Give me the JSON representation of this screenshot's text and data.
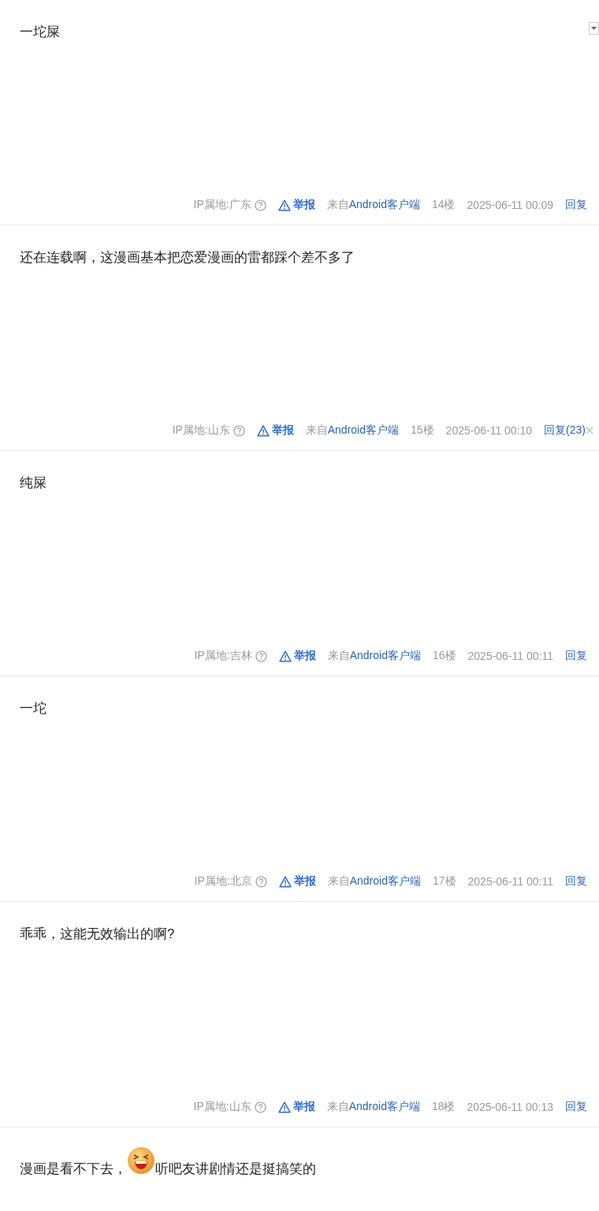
{
  "posts": [
    {
      "content": [
        {
          "kind": "text",
          "text": "一坨屎"
        }
      ],
      "menu": true,
      "closable": false,
      "ip": "IP属地:广东",
      "report": "举报",
      "source_prefix": "来自",
      "source": "Android客户端",
      "floor": "14楼",
      "time": "2025-06-11 00:09",
      "reply": "回复"
    },
    {
      "content": [
        {
          "kind": "text",
          "text": "还在连载啊，这漫画基本把恋爱漫画的雷都踩个差不多了"
        }
      ],
      "menu": false,
      "closable": true,
      "ip": "IP属地:山东",
      "report": "举报",
      "source_prefix": "来自",
      "source": "Android客户端",
      "floor": "15楼",
      "time": "2025-06-11 00:10",
      "reply": "回复(23)"
    },
    {
      "content": [
        {
          "kind": "text",
          "text": "纯屎"
        }
      ],
      "menu": false,
      "closable": false,
      "ip": "IP属地:吉林",
      "report": "举报",
      "source_prefix": "来自",
      "source": "Android客户端",
      "floor": "16楼",
      "time": "2025-06-11 00:11",
      "reply": "回复"
    },
    {
      "content": [
        {
          "kind": "text",
          "text": "一坨"
        }
      ],
      "menu": false,
      "closable": false,
      "ip": "IP属地:北京",
      "report": "举报",
      "source_prefix": "来自",
      "source": "Android客户端",
      "floor": "17楼",
      "time": "2025-06-11 00:11",
      "reply": "回复"
    },
    {
      "content": [
        {
          "kind": "text",
          "text": "乖乖，这能无效输出的啊?"
        }
      ],
      "menu": false,
      "closable": false,
      "ip": "IP属地:山东",
      "report": "举报",
      "source_prefix": "来自",
      "source": "Android客户端",
      "floor": "18楼",
      "time": "2025-06-11 00:13",
      "reply": "回复"
    },
    {
      "content": [
        {
          "kind": "text",
          "text": "漫画是看不下去，"
        },
        {
          "kind": "emoji"
        },
        {
          "kind": "text",
          "text": "听吧友讲剧情还是挺搞笑的"
        }
      ],
      "partial": true
    }
  ]
}
